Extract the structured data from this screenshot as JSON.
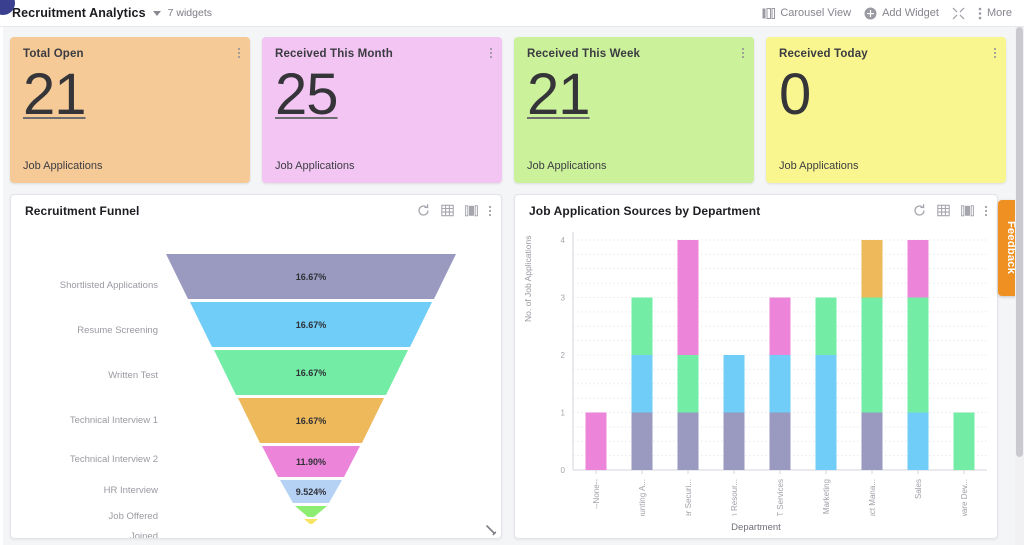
{
  "topbar": {
    "title": "Recruitment Analytics",
    "widget_count": "7 widgets",
    "caret_icon": "chevron-down-icon",
    "actions": [
      {
        "label": "Carousel View",
        "icon": "carousel-icon"
      },
      {
        "label": "Add Widget",
        "icon": "plus-circle-icon"
      },
      {
        "label": "",
        "icon": "fullscreen-icon"
      },
      {
        "label": "More",
        "icon": "kebab-icon"
      }
    ]
  },
  "kpi_cards": [
    {
      "title": "Total Open",
      "value": "21",
      "subtitle": "Job Applications",
      "color": "#f5ca96",
      "underlined": true
    },
    {
      "title": "Received This Month",
      "value": "25",
      "subtitle": "Job Applications",
      "color": "#f3c5f3",
      "underlined": true
    },
    {
      "title": "Received This Week",
      "value": "21",
      "subtitle": "Job Applications",
      "color": "#cbf19a",
      "underlined": true
    },
    {
      "title": "Received Today",
      "value": "0",
      "subtitle": "Job Applications",
      "color": "#f9f68f",
      "underlined": false
    }
  ],
  "funnel_panel": {
    "title": "Recruitment Funnel",
    "tools": [
      "refresh-icon",
      "table-icon",
      "card-view-icon",
      "kebab-icon"
    ]
  },
  "bars_panel": {
    "title": "Job Application Sources by Department",
    "tools": [
      "refresh-icon",
      "table-icon",
      "card-view-icon",
      "kebab-icon"
    ]
  },
  "feedback": {
    "label": "Feedback",
    "color": "#ef9122"
  },
  "chart_data": [
    {
      "type": "funnel",
      "title": "Recruitment Funnel",
      "stages": [
        {
          "label": "Shortlisted Applications",
          "pct": "16.67%",
          "value": 16.67,
          "color": "#9a9ac0"
        },
        {
          "label": "Resume Screening",
          "pct": "16.67%",
          "value": 16.67,
          "color": "#6fcdf7"
        },
        {
          "label": "Written Test",
          "pct": "16.67%",
          "value": 16.67,
          "color": "#73eda5"
        },
        {
          "label": "Technical Interview 1",
          "pct": "16.67%",
          "value": 16.67,
          "color": "#edb95a"
        },
        {
          "label": "Technical Interview 2",
          "pct": "11.90%",
          "value": 11.9,
          "color": "#ec84da"
        },
        {
          "label": "HR Interview",
          "pct": "9.524%",
          "value": 9.524,
          "color": "#b5d2f5"
        },
        {
          "label": "Job Offered",
          "pct": "",
          "value": 4.76,
          "color": "#8ced72"
        },
        {
          "label": "Joined",
          "pct": "",
          "value": 1.19,
          "color": "#f7e463"
        }
      ]
    },
    {
      "type": "bar",
      "stacked": true,
      "title": "Job Application Sources by Department",
      "xlabel": "Department",
      "ylabel": "No. of Job Applications",
      "ylim": [
        0,
        4
      ],
      "yticks": [
        "0",
        "1",
        "2",
        "3",
        "4"
      ],
      "grid": true,
      "legend": "none",
      "categories": [
        "--None--",
        "Accounting A...",
        "Cyber Securi...",
        "Human Resour...",
        "IT Services",
        "Marketing",
        "Product Mana...",
        "Sales",
        "Software Dev..."
      ],
      "series": [
        {
          "name": "purple",
          "color": "#9a9ac0",
          "values": [
            0,
            1,
            1,
            1,
            1,
            0,
            1,
            0,
            0
          ]
        },
        {
          "name": "blue",
          "color": "#6fcdf7",
          "values": [
            0,
            1,
            0,
            1,
            1,
            2,
            0,
            1,
            0
          ]
        },
        {
          "name": "green",
          "color": "#73eda5",
          "values": [
            0,
            1,
            1,
            0,
            0,
            1,
            2,
            2,
            1
          ]
        },
        {
          "name": "pink",
          "color": "#ec84da",
          "values": [
            1,
            0,
            2,
            0,
            1,
            0,
            0,
            1,
            0
          ]
        },
        {
          "name": "orange",
          "color": "#edb95a",
          "values": [
            0,
            0,
            0,
            0,
            0,
            0,
            1,
            0,
            0
          ]
        }
      ],
      "totals": [
        1,
        3,
        4,
        2,
        3,
        3,
        4,
        4,
        1
      ]
    }
  ]
}
